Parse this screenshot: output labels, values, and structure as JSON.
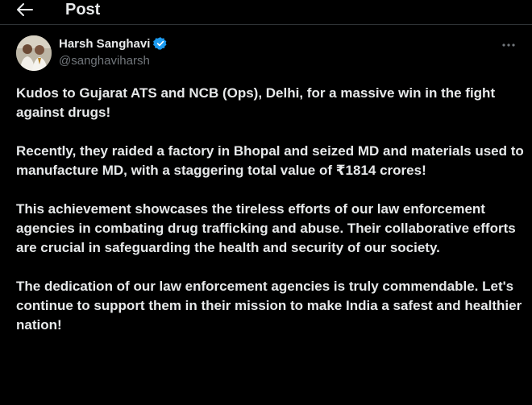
{
  "header": {
    "back_icon": "arrow-left-icon",
    "title": "Post"
  },
  "author": {
    "name": "Harsh Sanghavi",
    "handle": "@sanghaviharsh",
    "verified": true,
    "verified_color": "#1d9bf0"
  },
  "menu": {
    "icon": "more-horizontal-icon"
  },
  "tweet": {
    "paragraphs": [
      "Kudos to Gujarat ATS and NCB (Ops), Delhi, for a massive win in the fight against drugs!",
      "Recently, they raided a factory in Bhopal and seized MD and materials used to manufacture MD, with a staggering total value of ₹1814 crores!",
      "This achievement showcases the tireless efforts of our law enforcement agencies in combating drug trafficking and abuse. Their collaborative efforts are crucial in safeguarding the health and security of our society.",
      "The dedication of our law enforcement agencies is truly commendable. Let's continue to support them in their mission to make India a safest and healthier nation!"
    ]
  },
  "colors": {
    "background": "#000000",
    "text_primary": "#e7e9ea",
    "text_secondary": "#71767b",
    "divider": "#2f3336"
  }
}
